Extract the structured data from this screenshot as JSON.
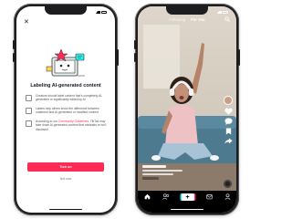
{
  "left_phone": {
    "title": "Labeling AI-generated content",
    "items": [
      {
        "text": "Creators should label content that's completely AI-generated or significantly edited by AI"
      },
      {
        "text": "Labels help others know the difference between unaltered and AI-generated or modified content"
      },
      {
        "text_before": "According to our",
        "link": "Community Guidelines",
        "text_after": ", TikTok may take down AI-generated content that misleads or isn't disclosed"
      }
    ],
    "primary_button": "Turn on",
    "secondary_link": "Not now",
    "close_icon": "close-icon",
    "colors": {
      "accent": "#fe2c55",
      "text": "#161823"
    }
  },
  "right_phone": {
    "feed_tabs": [
      "Following",
      "For You"
    ],
    "active_tab": "For You",
    "action_rail": {
      "avatar": "avatar",
      "icons": [
        "heart-icon",
        "comment-icon",
        "bookmark-icon",
        "share-icon"
      ]
    },
    "nav": [
      {
        "icon": "home-icon",
        "active": true
      },
      {
        "icon": "friends-icon",
        "active": false
      },
      {
        "icon": "create-icon",
        "active": false
      },
      {
        "icon": "inbox-icon",
        "active": false
      },
      {
        "icon": "profile-icon",
        "active": false
      }
    ],
    "colors": {
      "nav_bg": "#000000",
      "create_left": "#25f4ee",
      "create_right": "#fe2c55"
    }
  }
}
